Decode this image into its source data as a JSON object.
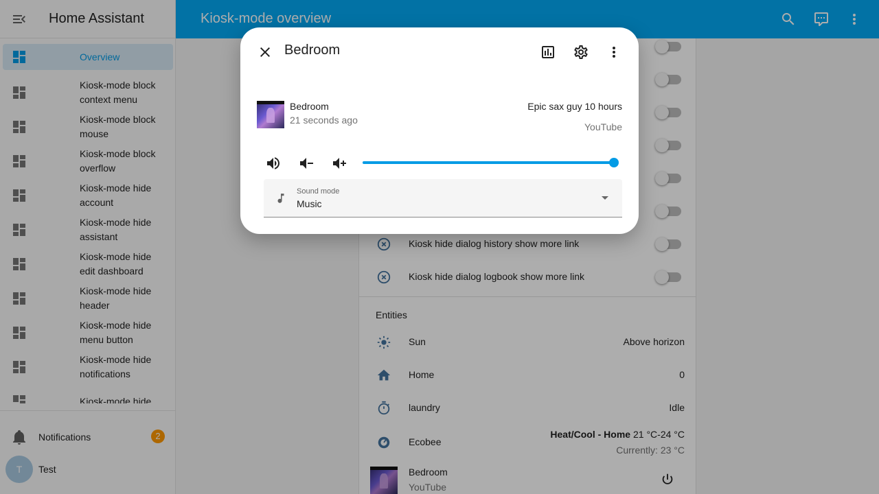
{
  "sidebar": {
    "title": "Home Assistant",
    "items": [
      {
        "line1": "Overview",
        "line2": "",
        "active": true
      },
      {
        "line1": "Kiosk-mode block",
        "line2": "context menu"
      },
      {
        "line1": "Kiosk-mode block",
        "line2": "mouse"
      },
      {
        "line1": "Kiosk-mode block",
        "line2": "overflow"
      },
      {
        "line1": "Kiosk-mode hide",
        "line2": "account"
      },
      {
        "line1": "Kiosk-mode hide",
        "line2": "assistant"
      },
      {
        "line1": "Kiosk-mode hide",
        "line2": "edit dashboard"
      },
      {
        "line1": "Kiosk-mode hide",
        "line2": "header"
      },
      {
        "line1": "Kiosk-mode hide",
        "line2": "menu button"
      },
      {
        "line1": "Kiosk-mode hide",
        "line2": "notifications"
      },
      {
        "line1": "Kiosk-mode hide",
        "line2": ""
      }
    ],
    "notifications_label": "Notifications",
    "notifications_count": "2",
    "user_initial": "T",
    "user_name": "Test"
  },
  "header": {
    "title": "Kiosk-mode overview",
    "icons": [
      "search-icon",
      "assist-icon",
      "overflow-menu-icon"
    ]
  },
  "background_rows": [
    {
      "label": "Kiosk hide dialog history show more link"
    },
    {
      "label": "Kiosk hide dialog logbook show more link"
    }
  ],
  "entities": {
    "title": "Entities",
    "rows": [
      {
        "name": "Sun",
        "state": "Above horizon",
        "icon": "sun-icon"
      },
      {
        "name": "Home",
        "state": "0",
        "icon": "home-icon"
      },
      {
        "name": "laundry",
        "state": "Idle",
        "icon": "timer-icon"
      },
      {
        "name": "Ecobee",
        "state_bold": "Heat/Cool - Home",
        "state": "21 °C-24 °C",
        "sub": "Currently: 23 °C",
        "icon": "thermostat-icon"
      },
      {
        "name": "Bedroom",
        "sub": "YouTube",
        "icon": "power-icon"
      }
    ]
  },
  "dialog": {
    "title": "Bedroom",
    "player_name": "Bedroom",
    "updated": "21 seconds ago",
    "media_title": "Epic sax guy 10 hours",
    "app_name": "YouTube",
    "volume": 1.0,
    "sound_mode_label": "Sound mode",
    "sound_mode_value": "Music"
  },
  "colors": {
    "primary": "#03a9f4",
    "accent": "#ff9800"
  }
}
